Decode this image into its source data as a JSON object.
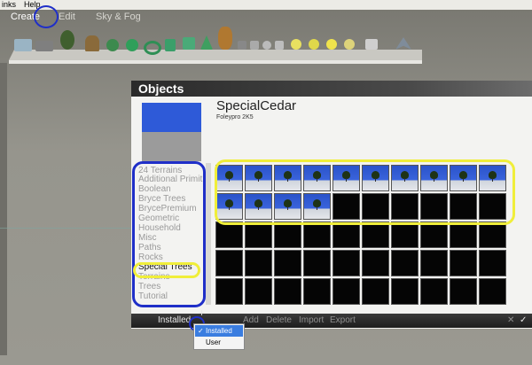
{
  "menu": {
    "items": [
      "inks",
      "Help"
    ]
  },
  "nav": {
    "create": "Create",
    "edit": "Edit",
    "sky": "Sky & Fog"
  },
  "toolbar": {
    "icons": [
      "terrain-icon",
      "slab-icon",
      "tree-icon",
      "rock-icon",
      "spiral-icon",
      "sphere-icon",
      "torus-icon",
      "cylinder-icon",
      "cube-icon",
      "cone-icon",
      "figure-icon",
      "primitive-icon",
      "flat-icon",
      "circle-icon",
      "square-icon",
      "sphere-lights-icon",
      "lamp-icon",
      "star-lamp-icon",
      "radial-icon",
      "box-icon",
      "wavefront-icon"
    ]
  },
  "panel": {
    "title": "Objects",
    "object_name": "SpecialCedar",
    "object_author": "Foleypro 2K5",
    "categories": [
      "24 Terrains",
      "Additional Primit",
      "Boolean",
      "Bryce Trees",
      "BrycePremium",
      "Geometric",
      "Household",
      "Misc",
      "Paths",
      "Rocks",
      "Special Trees",
      "Terrains",
      "Trees",
      "Tutorial"
    ],
    "selected_category": "Special Trees",
    "grid": {
      "rows": 5,
      "cols": 10,
      "filled": 14
    }
  },
  "bottom_bar": {
    "installed": "Installed",
    "add": "Add",
    "delete": "Delete",
    "import": "Import",
    "export": "Export",
    "plus": "+"
  },
  "dropdown": {
    "options": [
      "Installed",
      "User"
    ],
    "selected": "Installed"
  },
  "colors": {
    "highlight_blue": "#1f2fc8",
    "highlight_yellow": "#f0ee3a"
  }
}
